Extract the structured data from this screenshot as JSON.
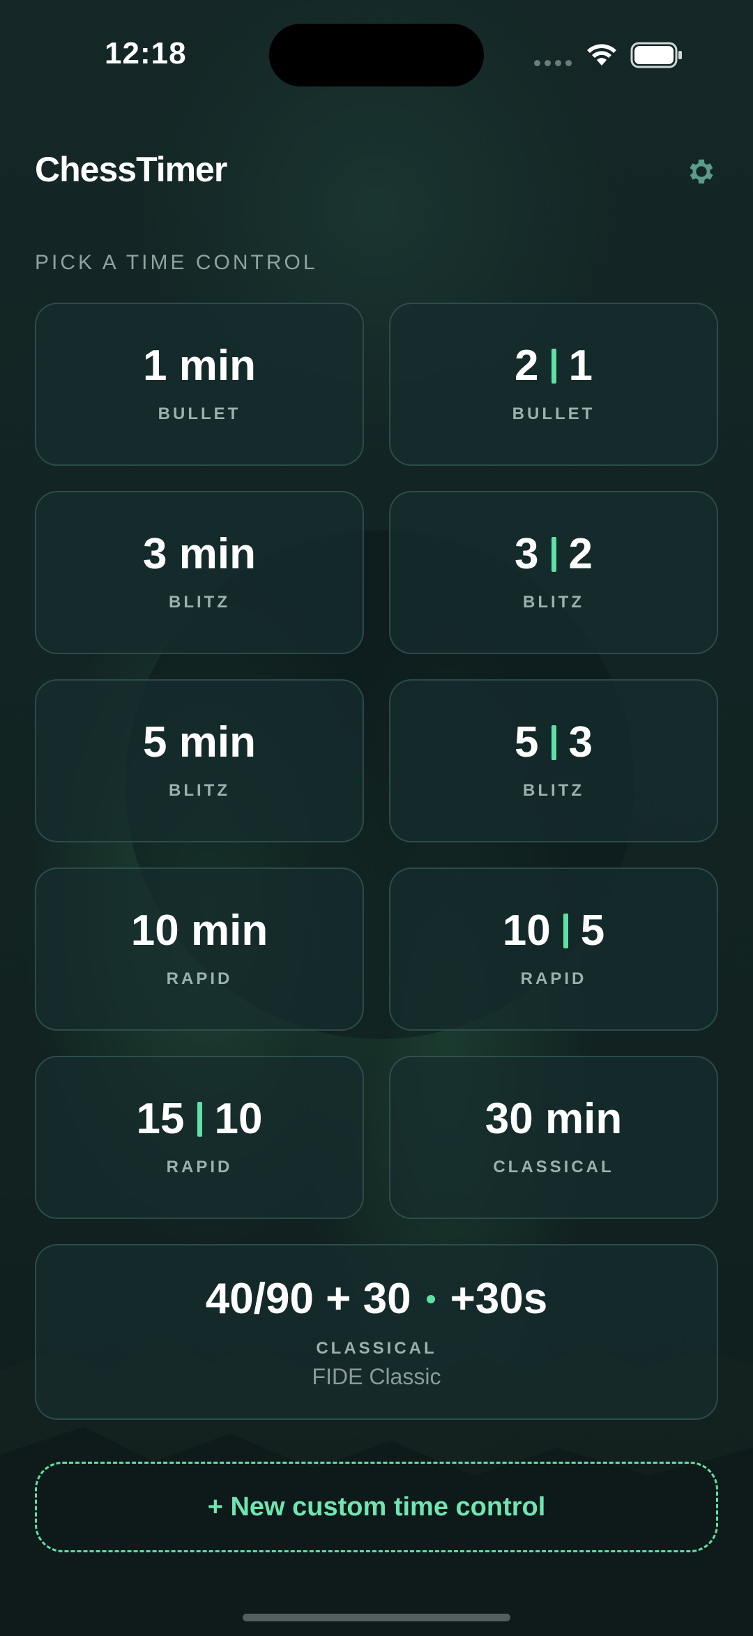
{
  "status_bar": {
    "time": "12:18"
  },
  "header": {
    "title": "ChessTimer",
    "settings_icon": "gear-icon"
  },
  "section_label": "PICK A TIME CONTROL",
  "presets": [
    {
      "main": "1 min",
      "a": "",
      "b": "",
      "category": "BULLET"
    },
    {
      "main": "",
      "a": "2",
      "b": "1",
      "category": "BULLET"
    },
    {
      "main": "3 min",
      "a": "",
      "b": "",
      "category": "BLITZ"
    },
    {
      "main": "",
      "a": "3",
      "b": "2",
      "category": "BLITZ"
    },
    {
      "main": "5 min",
      "a": "",
      "b": "",
      "category": "BLITZ"
    },
    {
      "main": "",
      "a": "5",
      "b": "3",
      "category": "BLITZ"
    },
    {
      "main": "10 min",
      "a": "",
      "b": "",
      "category": "RAPID"
    },
    {
      "main": "",
      "a": "10",
      "b": "5",
      "category": "RAPID"
    },
    {
      "main": "",
      "a": "15",
      "b": "10",
      "category": "RAPID"
    },
    {
      "main": "30 min",
      "a": "",
      "b": "",
      "category": "CLASSICAL"
    }
  ],
  "fide_card": {
    "main_left": "40/90 + 30",
    "main_right": "+30s",
    "category": "CLASSICAL",
    "note": "FIDE Classic"
  },
  "custom_button": {
    "label": "+ New custom time control"
  },
  "colors": {
    "accent": "#5ee0a8",
    "card_bg": "#162c2e",
    "background": "#112220"
  }
}
